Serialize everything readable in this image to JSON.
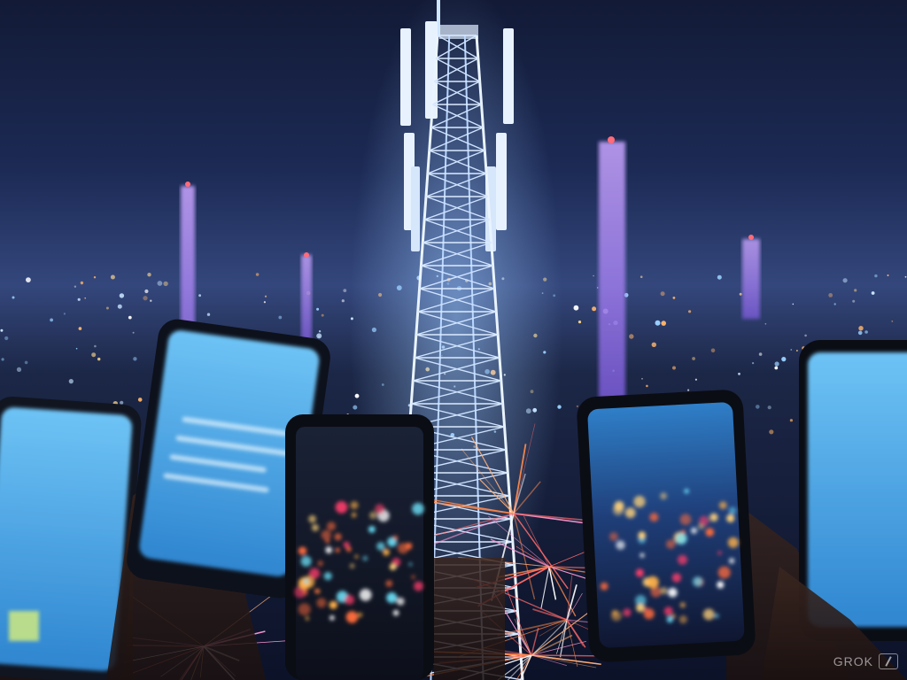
{
  "scene": {
    "subject": "cell-tower",
    "watermark_text": "GROK",
    "colors": {
      "sky_top": "#151c3d",
      "sky_horizon": "#3a4f8a",
      "tower_glow": "#7fb8ff",
      "spire_purple": "#a57bff",
      "phone_screen": "#4fa8e8",
      "network_lines": "#ff7a4a"
    }
  }
}
